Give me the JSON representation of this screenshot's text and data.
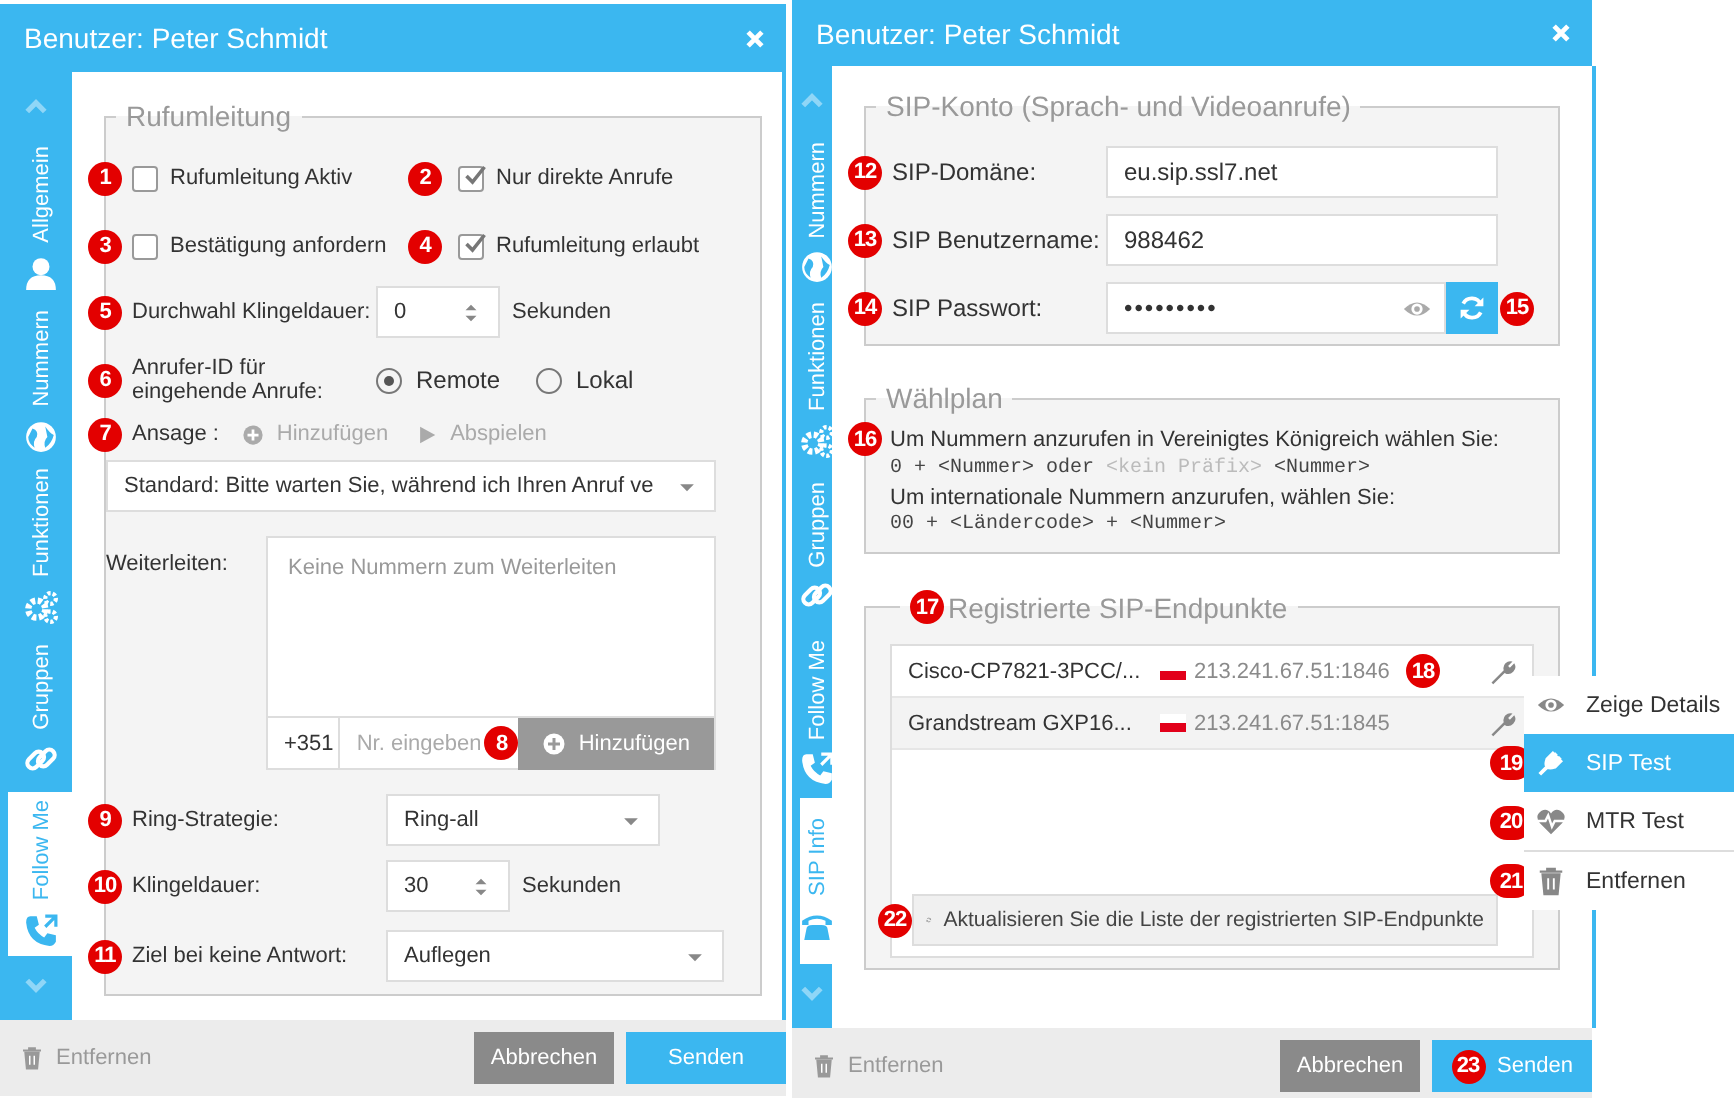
{
  "follow_me_dialog": {
    "title": "Benutzer: Peter Schmidt",
    "tabs": [
      {
        "label": "Allgemein",
        "selected": false
      },
      {
        "label": "Nummern",
        "selected": false
      },
      {
        "label": "Funktionen",
        "selected": false
      },
      {
        "label": "Gruppen",
        "selected": false
      },
      {
        "label": "Follow Me",
        "selected": true
      }
    ],
    "legend": "Rufumleitung",
    "checkboxes": [
      {
        "badge": "1",
        "label": "Rufumleitung Aktiv",
        "checked": false
      },
      {
        "badge": "2",
        "label": "Nur direkte Anrufe",
        "checked": true
      },
      {
        "badge": "3",
        "label": "Bestätigung anfordern",
        "checked": false
      },
      {
        "badge": "4",
        "label": "Rufumleitung erlaubt",
        "checked": true
      }
    ],
    "ring_delay": {
      "badge": "5",
      "label": "Durchwahl Klingeldauer:",
      "value": "0",
      "unit": "Sekunden"
    },
    "caller_id": {
      "badge": "6",
      "label": "Anrufer-ID für eingehende Anrufe:",
      "options": [
        {
          "label": "Remote",
          "selected": true
        },
        {
          "label": "Lokal",
          "selected": false
        }
      ]
    },
    "announcement": {
      "badge": "7",
      "label": "Ansage :",
      "actions": [
        {
          "label": "Hinzufügen",
          "disabled": true
        },
        {
          "label": "Abspielen",
          "disabled": true
        }
      ],
      "value": "Standard: Bitte warten Sie, während ich Ihren Anruf ve"
    },
    "forwarding": {
      "label": "Weiterleiten:",
      "empty_text": "Keine Nummern zum Weiterleiten",
      "prefix": "+351",
      "placeholder": "Nr. eingeben",
      "badge": "8",
      "button": "Hinzufügen"
    },
    "ring_strategy": {
      "badge": "9",
      "label": "Ring-Strategie:",
      "value": "Ring-all"
    },
    "ring_time": {
      "badge": "10",
      "label": "Klingeldauer:",
      "value": "30",
      "unit": "Sekunden"
    },
    "no_answer": {
      "badge": "11",
      "label": "Ziel bei keine Antwort:",
      "value": "Auflegen"
    },
    "footer": {
      "remove": "Entfernen",
      "cancel": "Abbrechen",
      "send": "Senden"
    }
  },
  "sip_info_dialog": {
    "title": "Benutzer: Peter Schmidt",
    "tabs": [
      {
        "label": "Nummern",
        "selected": false
      },
      {
        "label": "Funktionen",
        "selected": false
      },
      {
        "label": "Gruppen",
        "selected": false
      },
      {
        "label": "Follow Me",
        "selected": false
      },
      {
        "label": "SIP Info",
        "selected": true
      }
    ],
    "account": {
      "legend": "SIP-Konto (Sprach- und Videoanrufe)",
      "fields": [
        {
          "badge": "12",
          "label": "SIP-Domäne:",
          "value": "eu.sip.ssl7.net",
          "kind": "text"
        },
        {
          "badge": "13",
          "label": "SIP Benutzername:",
          "value": "988462",
          "kind": "text"
        },
        {
          "badge": "14",
          "label": "SIP Passwort:",
          "value": "•••••••••",
          "kind": "password",
          "button_badge": "15"
        }
      ]
    },
    "dial_plan": {
      "legend": "Wählplan",
      "badge": "16",
      "lines": [
        {
          "kind": "text",
          "parts": [
            {
              "text": "Um Nummern anzurufen in Vereinigtes Königreich wählen Sie:",
              "muted": false
            }
          ]
        },
        {
          "kind": "code",
          "parts": [
            {
              "text": "0 + <Nummer> oder ",
              "muted": false
            },
            {
              "text": "<kein Präfix>",
              "muted": true
            },
            {
              "text": " <Nummer>",
              "muted": false
            }
          ]
        },
        {
          "kind": "text",
          "parts": [
            {
              "text": "Um internationale Nummern anzurufen, wählen Sie:",
              "muted": false
            }
          ]
        },
        {
          "kind": "code",
          "parts": [
            {
              "text": "00 + <Ländercode> + <Nummer>",
              "muted": false
            }
          ]
        }
      ]
    },
    "endpoints": {
      "badge": "17",
      "legend": "Registrierte SIP-Endpunkte",
      "rows": [
        {
          "name": "Cisco-CP7821-3PCC/...",
          "address": "213.241.67.51:1846",
          "selected": false,
          "badge": "18"
        },
        {
          "name": "Grandstream GXP16...",
          "address": "213.241.67.51:1845",
          "selected": true
        }
      ],
      "refresh": {
        "badge": "22",
        "label": "Aktualisieren Sie die Liste der registrierten SIP-Endpunkte"
      }
    },
    "footer": {
      "remove": "Entfernen",
      "cancel": "Abbrechen",
      "send": "Senden",
      "send_badge": "23"
    }
  },
  "context_menu": [
    {
      "label": "Zeige Details",
      "selected": false
    },
    {
      "badge": "19",
      "label": "SIP Test",
      "selected": true
    },
    {
      "badge": "20",
      "label": "MTR Test",
      "selected": false
    },
    {
      "badge": "21",
      "label": "Entfernen",
      "selected": false
    }
  ]
}
